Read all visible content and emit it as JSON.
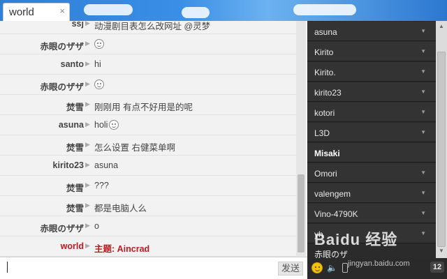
{
  "tab": {
    "title": "world",
    "close": "×"
  },
  "messages": [
    {
      "name": "ssj",
      "text": "动漫剧目表怎么改网址 @灵梦",
      "smiley": false,
      "system": false
    },
    {
      "name": "赤眼のザザ",
      "text": "",
      "smiley": true,
      "system": false
    },
    {
      "name": "santo",
      "text": "hi",
      "smiley": false,
      "system": false
    },
    {
      "name": "赤眼のザザ",
      "text": "",
      "smiley": true,
      "system": false
    },
    {
      "name": "焚雪",
      "text": "刚刚用 有点不好用是的呢",
      "smiley": false,
      "system": false
    },
    {
      "name": "asuna",
      "text": "holi",
      "smiley": true,
      "system": false
    },
    {
      "name": "焚雪",
      "text": "怎么设置 右健菜单啊",
      "smiley": false,
      "system": false
    },
    {
      "name": "kirito23",
      "text": "asuna",
      "smiley": false,
      "system": false
    },
    {
      "name": "焚雪",
      "text": "???",
      "smiley": false,
      "system": false
    },
    {
      "name": "焚雪",
      "text": "都是电脑人么",
      "smiley": false,
      "system": false
    },
    {
      "name": "赤眼のザザ",
      "text": "o",
      "smiley": false,
      "system": false
    },
    {
      "name": "world",
      "text": "主题: Aincrad",
      "smiley": false,
      "system": true
    }
  ],
  "users": [
    {
      "name": "asuna",
      "bold": false
    },
    {
      "name": "Kirito",
      "bold": false
    },
    {
      "name": "Kirito.",
      "bold": false
    },
    {
      "name": "kirito23",
      "bold": false
    },
    {
      "name": "kotori",
      "bold": false
    },
    {
      "name": "L3D",
      "bold": false
    },
    {
      "name": "Misaki",
      "bold": true
    },
    {
      "name": "Omori",
      "bold": false
    },
    {
      "name": "valengem",
      "bold": false
    },
    {
      "name": "Vino-4790K",
      "bold": false
    },
    {
      "name": "yh",
      "bold": false
    }
  ],
  "partial_user": "赤眼のザ",
  "input": {
    "send_label": "发送"
  },
  "toolbar": {
    "online_count": "12"
  },
  "watermark": {
    "main": "Baidu 经验",
    "sub": "jingyan.baidu.com"
  },
  "colors": {
    "system": "#c0191f",
    "userlist_bg": "#333333"
  },
  "icons": {
    "arrow": "▶",
    "caret": "▼",
    "volume": "🔈"
  }
}
